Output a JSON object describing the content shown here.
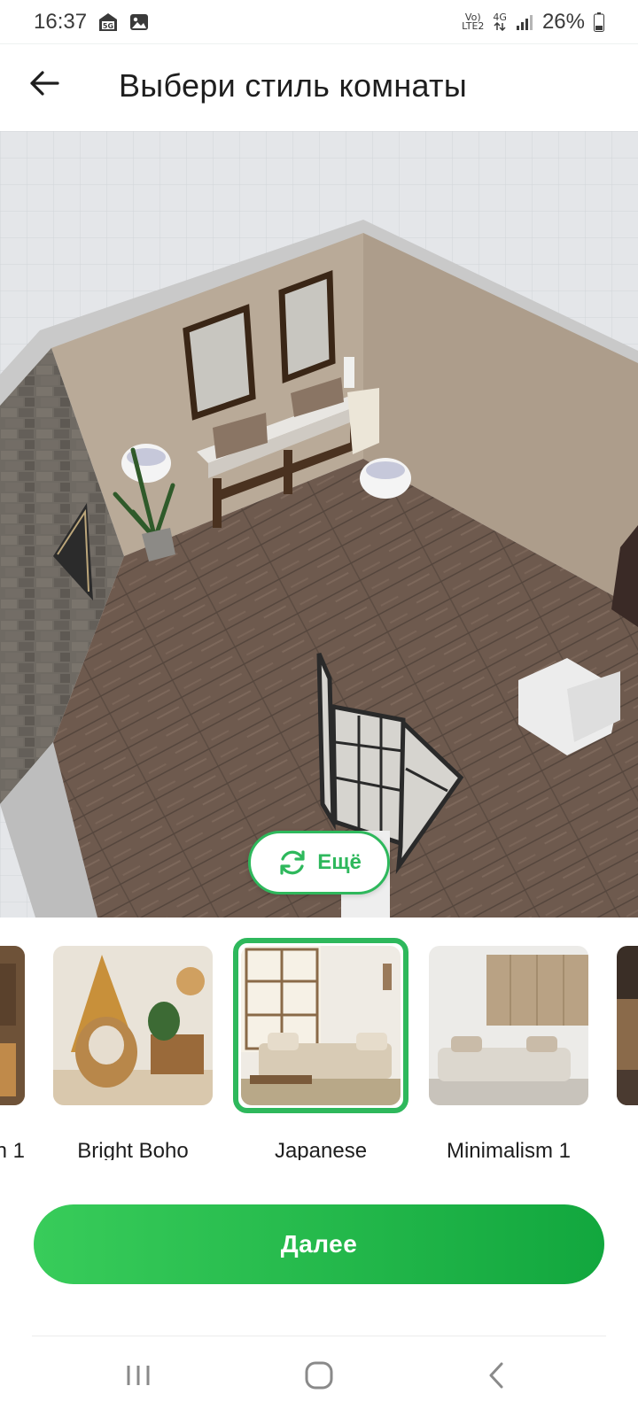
{
  "status_bar": {
    "time": "16:37",
    "left_icons": [
      "sim-5g-icon",
      "gallery-icon"
    ],
    "volte_label_1": "Vo)",
    "volte_label_2": "LTE2",
    "network_label": "4G",
    "battery_percent": "26%"
  },
  "header": {
    "title": "Выбери стиль комнаты",
    "back_icon": "arrow-left-icon"
  },
  "preview": {
    "more_button": {
      "label": "Ещё",
      "icon": "refresh-icon"
    }
  },
  "styles": [
    {
      "label": "n 1",
      "selected": false
    },
    {
      "label": "Bright Boho",
      "selected": false
    },
    {
      "label": "Japanese",
      "selected": true
    },
    {
      "label": "Minimalism 1",
      "selected": false
    },
    {
      "label": "",
      "selected": false
    }
  ],
  "next_button": {
    "label": "Далее"
  },
  "nav": {
    "recents_icon": "recents-icon",
    "home_icon": "home-icon",
    "back_icon": "back-icon"
  },
  "colors": {
    "accent": "#2eb85c",
    "button_gradient_start": "#38cc5a",
    "button_gradient_end": "#12a73e"
  }
}
